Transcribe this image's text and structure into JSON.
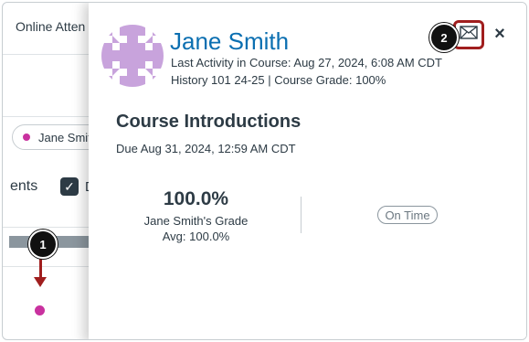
{
  "background": {
    "header_text": "Online Atten",
    "student_filter_label": "Jane Smit",
    "section_text_fragment": "ents",
    "checkbox_label_fragment": "D"
  },
  "markers": {
    "step1": "1",
    "step2": "2"
  },
  "tray": {
    "student_name": "Jane Smith",
    "last_activity": "Last Activity in Course: Aug 27, 2024, 6:08 AM CDT",
    "course_info": "History 101 24-25 | Course Grade: 100%",
    "assignment_title": "Course Introductions",
    "due_date": "Due Aug 31, 2024, 12:59 AM CDT",
    "grade_percent": "100.0%",
    "grade_label": "Jane Smith's Grade",
    "grade_average": "Avg: 100.0%",
    "submission_status": "On Time",
    "message_icon": "envelope-icon",
    "close_label": "×"
  },
  "colors": {
    "name_link": "#0b6fb1",
    "highlight_red": "#a01e1e",
    "student_dot": "#c9319f",
    "avatar_purple": "#c8a3dc"
  }
}
